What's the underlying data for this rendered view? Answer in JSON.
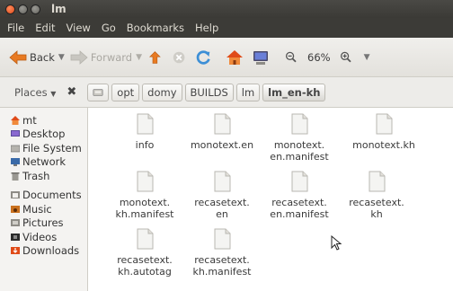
{
  "window": {
    "title": "lm"
  },
  "menubar": [
    "File",
    "Edit",
    "View",
    "Go",
    "Bookmarks",
    "Help"
  ],
  "toolbar": {
    "back_label": "Back",
    "forward_label": "Forward",
    "zoom": "66%"
  },
  "locationbar": {
    "places_label": "Places",
    "crumbs": [
      "opt",
      "domy",
      "BUILDS",
      "lm",
      "lm_en-kh"
    ]
  },
  "sidebar": {
    "items": [
      "mt",
      "Desktop",
      "File System",
      "Network",
      "Trash",
      "Documents",
      "Music",
      "Pictures",
      "Videos",
      "Downloads"
    ]
  },
  "files": [
    "info",
    "monotext.en",
    "monotext.\nen.manifest",
    "monotext.kh",
    "monotext.\nkh.manifest",
    "recasetext.\nen",
    "recasetext.\nen.manifest",
    "recasetext.\nkh",
    "recasetext.\nkh.autotag",
    "recasetext.\nkh.manifest"
  ],
  "colors": {
    "titlebar": "#3c3b37",
    "close_button": "#e95420",
    "menu_text": "#dfdbd2",
    "back_arrow": "#e87a22",
    "up_arrow": "#e87a22",
    "reload": "#3d8fd6"
  }
}
